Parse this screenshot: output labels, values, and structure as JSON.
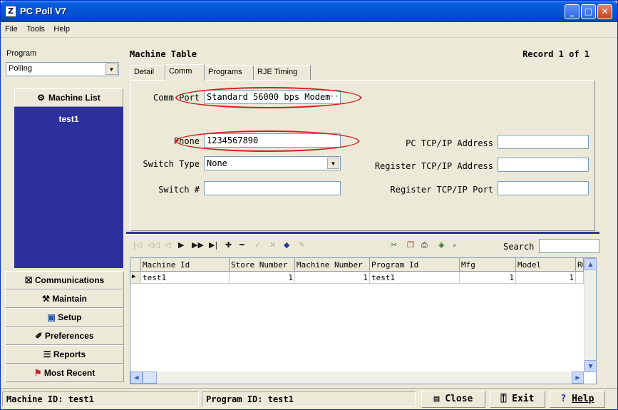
{
  "window": {
    "title": "PC Poll V7",
    "app_icon": "Z"
  },
  "menu": [
    "File",
    "Tools",
    "Help"
  ],
  "program": {
    "label": "Program",
    "value": "Polling"
  },
  "sidebar": {
    "machine_list": "Machine List",
    "items": [
      "test1"
    ],
    "buttons": [
      {
        "label": "Communications",
        "icon": "communications-icon"
      },
      {
        "label": "Maintain",
        "icon": "maintain-icon"
      },
      {
        "label": "Setup",
        "icon": "setup-icon"
      },
      {
        "label": "Preferences",
        "icon": "preferences-icon"
      },
      {
        "label": "Reports",
        "icon": "reports-icon"
      },
      {
        "label": "Most Recent",
        "icon": "flag-icon"
      }
    ]
  },
  "table": {
    "title": "Machine Table",
    "record": "Record 1 of 1"
  },
  "tabs": [
    "Detail",
    "Comm",
    "Programs",
    "RJE Timing"
  ],
  "active_tab": "Comm",
  "comm": {
    "comm_port_label": "Comm Port",
    "comm_port_value": "Standard 56000 bps Modem",
    "phone_label": "Phone",
    "phone_value": "1234567890",
    "switch_type_label": "Switch Type",
    "switch_type_value": "None",
    "switch_num_label": "Switch #",
    "switch_num_value": "",
    "pc_tcp_label": "PC TCP/IP Address",
    "pc_tcp_value": "",
    "reg_tcp_label": "Register TCP/IP Address",
    "reg_tcp_value": "",
    "reg_port_label": "Register TCP/IP Port",
    "reg_port_value": ""
  },
  "search": {
    "label": "Search",
    "value": ""
  },
  "grid": {
    "columns": [
      "Machine Id",
      "Store Number",
      "Machine Number",
      "Program Id",
      "Mfg",
      "Model",
      "ROM"
    ],
    "rows": [
      [
        "test1",
        "1",
        "1",
        "test1",
        "1",
        "1",
        ""
      ]
    ]
  },
  "status": {
    "machine_id": "Machine ID: test1",
    "program_id": "Program ID: test1",
    "close": "Close",
    "exit": "Exit",
    "help": "Help"
  },
  "colors": {
    "titlebar": "#0355d7",
    "panel": "#2e309d",
    "annotation": "#d42020",
    "background": "#ece9d8"
  }
}
